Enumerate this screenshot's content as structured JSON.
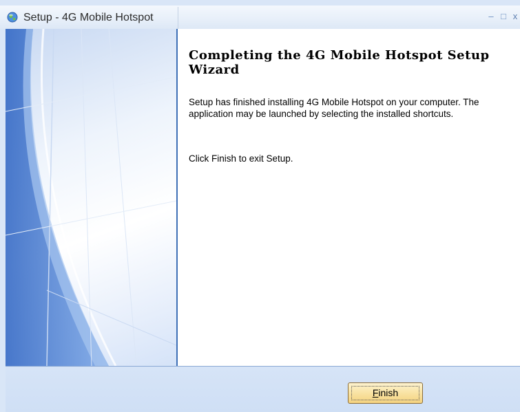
{
  "window": {
    "title": "Setup - 4G Mobile Hotspot",
    "minimize_glyph": "–",
    "maximize_glyph": "□",
    "close_glyph": "x"
  },
  "content": {
    "heading": "Completing the 4G Mobile Hotspot Setup Wizard",
    "paragraph1": "Setup has finished installing 4G Mobile Hotspot on your computer. The application may be launched by selecting the installed shortcuts.",
    "paragraph2": "Click Finish to exit Setup."
  },
  "buttons": {
    "finish_mnemonic": "F",
    "finish_rest": "inish"
  },
  "colors": {
    "accent_border": "#3d6fb6",
    "button_face": "#f9e3a3",
    "footer_bg": "#d6e4f7"
  },
  "icons": {
    "app": "setup-globe-icon",
    "minimize": "minimize-icon",
    "maximize": "maximize-icon",
    "close": "close-icon"
  }
}
